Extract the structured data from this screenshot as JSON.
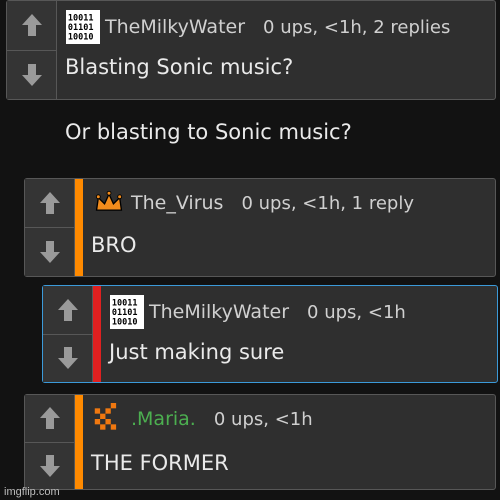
{
  "colors": {
    "background": "#121212",
    "panel": "#2f2f2f",
    "border": "#575757",
    "orange_stripe": "#ff8a00",
    "red_stripe": "#e02020",
    "highlight_border": "#3b9ad9",
    "green_username": "#4caf50"
  },
  "comments": [
    {
      "username": "TheMilkyWater",
      "meta": "0 ups, <1h, 2 replies",
      "body": "Blasting Sonic music?\n\nOr blasting to Sonic music?",
      "avatar": "binary-code-icon"
    },
    {
      "username": "The_Virus",
      "meta": "0 ups, <1h, 1 reply",
      "body": "BRO",
      "avatar": "crown-icon",
      "stripe": "orange"
    },
    {
      "username": "TheMilkyWater",
      "meta": "0 ups, <1h",
      "body": "Just making sure",
      "avatar": "binary-code-icon",
      "stripe": "red"
    },
    {
      "username": ".Maria.",
      "meta": "0 ups, <1h",
      "body": "THE FORMER",
      "avatar": "pixel-logo-icon",
      "stripe": "orange"
    }
  ],
  "watermark": "imgflip.com"
}
